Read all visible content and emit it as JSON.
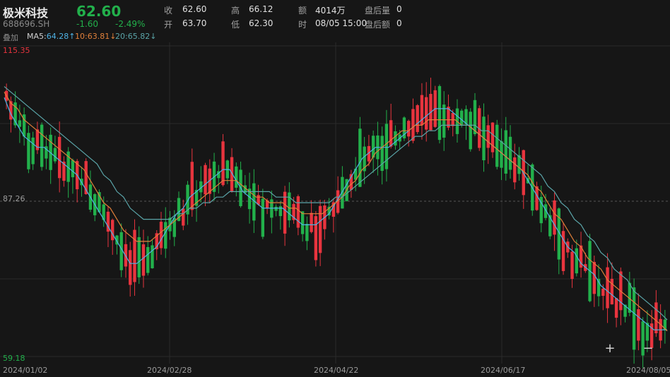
{
  "stock": {
    "name": "极米科技",
    "code": "688696.SH",
    "price": "62.60",
    "change": "-1.60",
    "change_pct": "-2.49%"
  },
  "quote": {
    "close_label": "收",
    "close": "62.60",
    "open_label": "开",
    "open": "63.70",
    "high_label": "高",
    "high": "66.12",
    "low_label": "低",
    "low": "62.30",
    "amount_label": "额",
    "amount": "4014万",
    "time_label": "时",
    "time": "08/05 15:00",
    "after_vol_label": "盘后量",
    "after_vol": "0",
    "after_amt_label": "盘后额",
    "after_amt": "0"
  },
  "indicators": {
    "overlay_label": "叠加",
    "ma5": "MA5:64.28↑",
    "ma10": "10:63.81↓",
    "ma20": "20:65.82↓"
  },
  "colors": {
    "up": "#e8343e",
    "down": "#22b04b",
    "ma5": "#4fb3e6",
    "ma10": "#e0803a",
    "ma20": "#5aa4a8",
    "price_change": "#22b04b",
    "background": "#161616"
  },
  "controls": {
    "zoom_in_icon": "+",
    "zoom_out_icon": "−"
  },
  "chart_data": {
    "type": "candlestick",
    "y_top_label": "115.35",
    "y_mid_label": "87.26",
    "y_bottom_label": "59.18",
    "ylim": [
      59.18,
      115.35
    ],
    "reference_line": 87.26,
    "x_labels": [
      "2024/01/02",
      "2024/02/28",
      "2024/04/22",
      "2024/06/17",
      "2024/08/05"
    ],
    "grid": true,
    "series": [
      {
        "name": "MA5",
        "values": [
          106,
          103,
          101,
          99,
          98,
          97,
          97,
          96,
          95,
          94,
          93,
          92,
          90,
          88,
          86,
          84,
          82,
          80,
          78,
          76,
          76,
          77,
          78,
          79,
          81,
          83,
          85,
          86,
          88,
          89,
          90,
          91,
          92,
          93,
          93,
          91,
          89,
          88,
          87,
          86,
          86,
          86,
          86,
          85,
          84,
          83,
          83,
          83,
          84,
          85,
          87,
          89,
          91,
          93,
          95,
          96,
          97,
          97,
          97,
          98,
          99,
          100,
          101,
          102,
          103,
          104,
          104,
          104,
          103,
          102,
          101,
          100,
          99,
          98,
          97,
          96,
          95,
          94,
          93,
          91,
          89,
          87,
          85,
          83,
          81,
          79,
          78,
          76,
          75,
          74,
          72,
          71,
          70,
          69,
          68,
          67,
          66,
          65,
          64,
          64,
          64
        ]
      },
      {
        "name": "10",
        "values": [
          107,
          105,
          104,
          102,
          101,
          100,
          99,
          98,
          97,
          96,
          95,
          94,
          93,
          91,
          89,
          87,
          86,
          84,
          82,
          81,
          80,
          80,
          80,
          81,
          82,
          83,
          84,
          85,
          86,
          87,
          88,
          89,
          90,
          91,
          91,
          91,
          90,
          89,
          88,
          88,
          87,
          87,
          87,
          86,
          86,
          85,
          85,
          85,
          85,
          86,
          87,
          88,
          90,
          91,
          93,
          94,
          96,
          97,
          98,
          99,
          100,
          100,
          101,
          101,
          102,
          102,
          102,
          102,
          102,
          101,
          101,
          100,
          99,
          98,
          97,
          96,
          95,
          94,
          93,
          92,
          90,
          89,
          87,
          85,
          84,
          82,
          80,
          79,
          77,
          76,
          75,
          73,
          72,
          71,
          70,
          69,
          68,
          67,
          66,
          65,
          63.8
        ]
      },
      {
        "name": "20",
        "values": [
          108,
          107,
          106,
          105,
          104,
          103,
          102,
          101,
          100,
          99,
          98,
          97,
          96,
          95,
          94,
          92,
          91,
          89,
          88,
          86,
          85,
          84,
          84,
          84,
          84,
          84,
          85,
          85,
          86,
          86,
          87,
          87,
          88,
          88,
          89,
          89,
          89,
          89,
          89,
          89,
          89,
          88,
          88,
          88,
          87,
          87,
          87,
          87,
          87,
          87,
          88,
          88,
          89,
          90,
          91,
          92,
          93,
          94,
          95,
          96,
          97,
          98,
          99,
          99,
          100,
          100,
          101,
          101,
          101,
          101,
          101,
          101,
          100,
          100,
          99,
          98,
          97,
          96,
          95,
          94,
          93,
          92,
          90,
          89,
          87,
          86,
          84,
          83,
          81,
          80,
          78,
          77,
          75,
          74,
          73,
          71,
          70,
          69,
          68,
          67,
          65.8
        ]
      }
    ]
  }
}
